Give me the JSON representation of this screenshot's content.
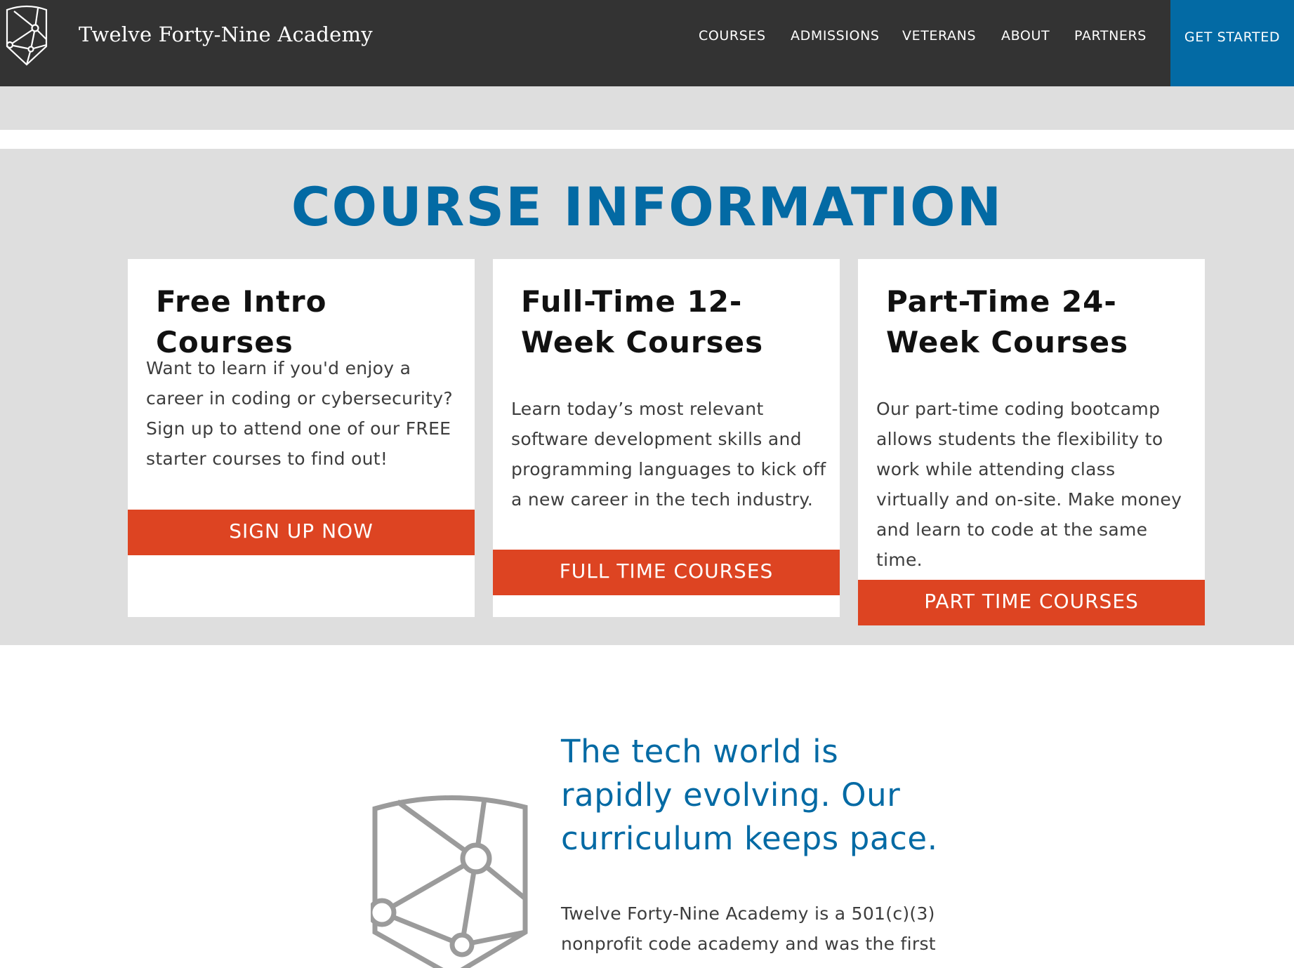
{
  "header": {
    "brand": "Twelve Forty-Nine Academy",
    "nav": [
      {
        "label": "COURSES"
      },
      {
        "label": "ADMISSIONS"
      },
      {
        "label": "VETERANS"
      },
      {
        "label": "ABOUT"
      },
      {
        "label": "PARTNERS"
      }
    ],
    "cta": "GET STARTED"
  },
  "course_section": {
    "title": "COURSE INFORMATION",
    "cards": [
      {
        "title": "Free Intro Courses",
        "body": "Want to learn if you'd enjoy a career in coding or cybersecurity? Sign up to attend one of our FREE starter courses to find out!",
        "button": "SIGN UP NOW"
      },
      {
        "title": "Full-Time 12-Week Courses",
        "body": "Learn today’s most relevant software development skills and programming languages to kick off a new career in the tech industry.",
        "button": "FULL TIME COURSES"
      },
      {
        "title": "Part-Time 24-Week Courses",
        "body": "Our part-time coding bootcamp allows students the flexibility to work while attending class virtually and on-site. Make money and learn to code at the same time.",
        "button": "PART TIME COURSES"
      }
    ]
  },
  "about": {
    "heading": "The tech world is rapidly evolving. Our curriculum keeps pace.",
    "body": "Twelve Forty-Nine Academy is a 501(c)(3) nonprofit code academy and was the first"
  },
  "colors": {
    "header_bg": "#333333",
    "accent_blue": "#036aa4",
    "button_orange": "#dd4422",
    "section_grey": "#dedede"
  },
  "icons": {
    "logo": "shield-network-logo-icon"
  }
}
